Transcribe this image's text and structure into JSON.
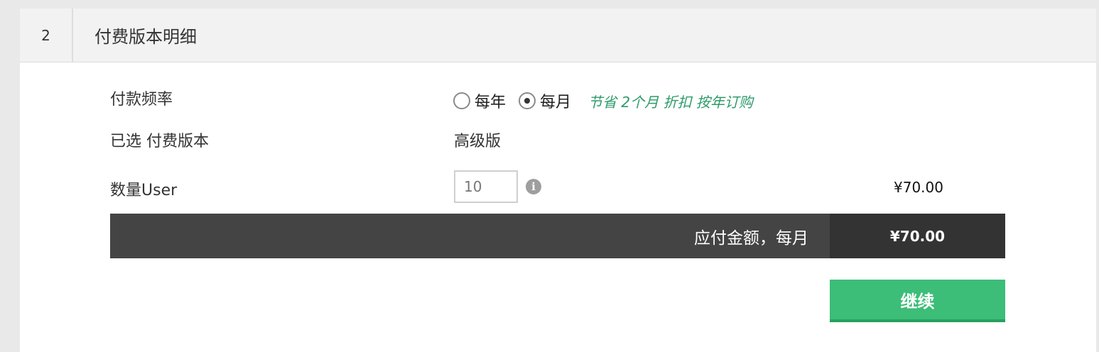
{
  "header": {
    "step_number": "2",
    "title": "付费版本明细"
  },
  "frequency": {
    "label": "付款频率",
    "options": [
      {
        "label": "每年",
        "checked": false
      },
      {
        "label": "每月",
        "checked": true
      }
    ],
    "promo": "节省 2个月 折扣 按年订购"
  },
  "selected_plan": {
    "label": "已选 付费版本",
    "value": "高级版"
  },
  "quantity": {
    "label": "数量User",
    "value": "10",
    "info_icon": "info-icon",
    "price": "¥70.00"
  },
  "total": {
    "label": "应付金额，每月",
    "value": "¥70.00"
  },
  "actions": {
    "continue_label": "继续"
  },
  "colors": {
    "accent": "#3cbd78",
    "promo_text": "#2e9a6a",
    "total_bar": "#444444",
    "total_value_bg": "#333333"
  }
}
